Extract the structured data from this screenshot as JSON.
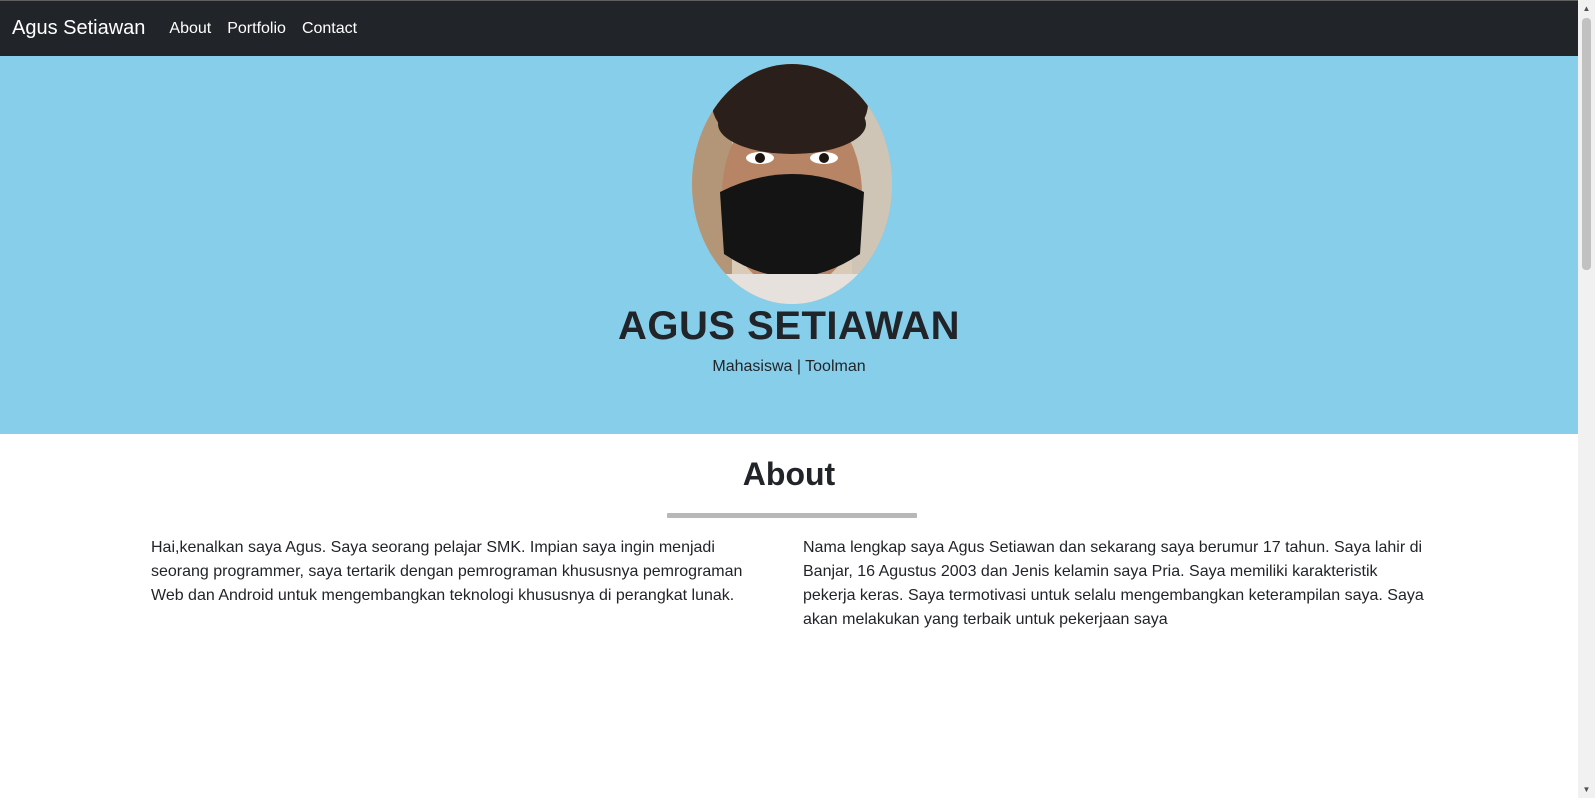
{
  "navbar": {
    "brand": "Agus Setiawan",
    "links": [
      {
        "label": "About"
      },
      {
        "label": "Portfolio"
      },
      {
        "label": "Contact"
      }
    ]
  },
  "hero": {
    "name": "AGUS SETIAWAN",
    "subtitle": "Mahasiswa | Toolman",
    "background_color": "#87ceeb"
  },
  "about": {
    "title": "About",
    "left_text": "Hai,kenalkan saya Agus. Saya seorang pelajar SMK. Impian saya ingin menjadi seorang programmer, saya tertarik dengan pemrograman khususnya pemrograman Web dan Android untuk mengembangkan teknologi khususnya di perangkat lunak.",
    "right_text": "Nama lengkap saya Agus Setiawan dan sekarang saya berumur 17 tahun. Saya lahir di Banjar, 16 Agustus 2003 dan Jenis kelamin saya Pria. Saya memiliki karakteristik pekerja keras. Saya termotivasi untuk selalu mengembangkan keterampilan saya. Saya akan melakukan yang terbaik untuk pekerjaan saya"
  },
  "scrollbar": {
    "up_icon": "chevron-up-icon",
    "down_icon": "chevron-down-icon"
  }
}
